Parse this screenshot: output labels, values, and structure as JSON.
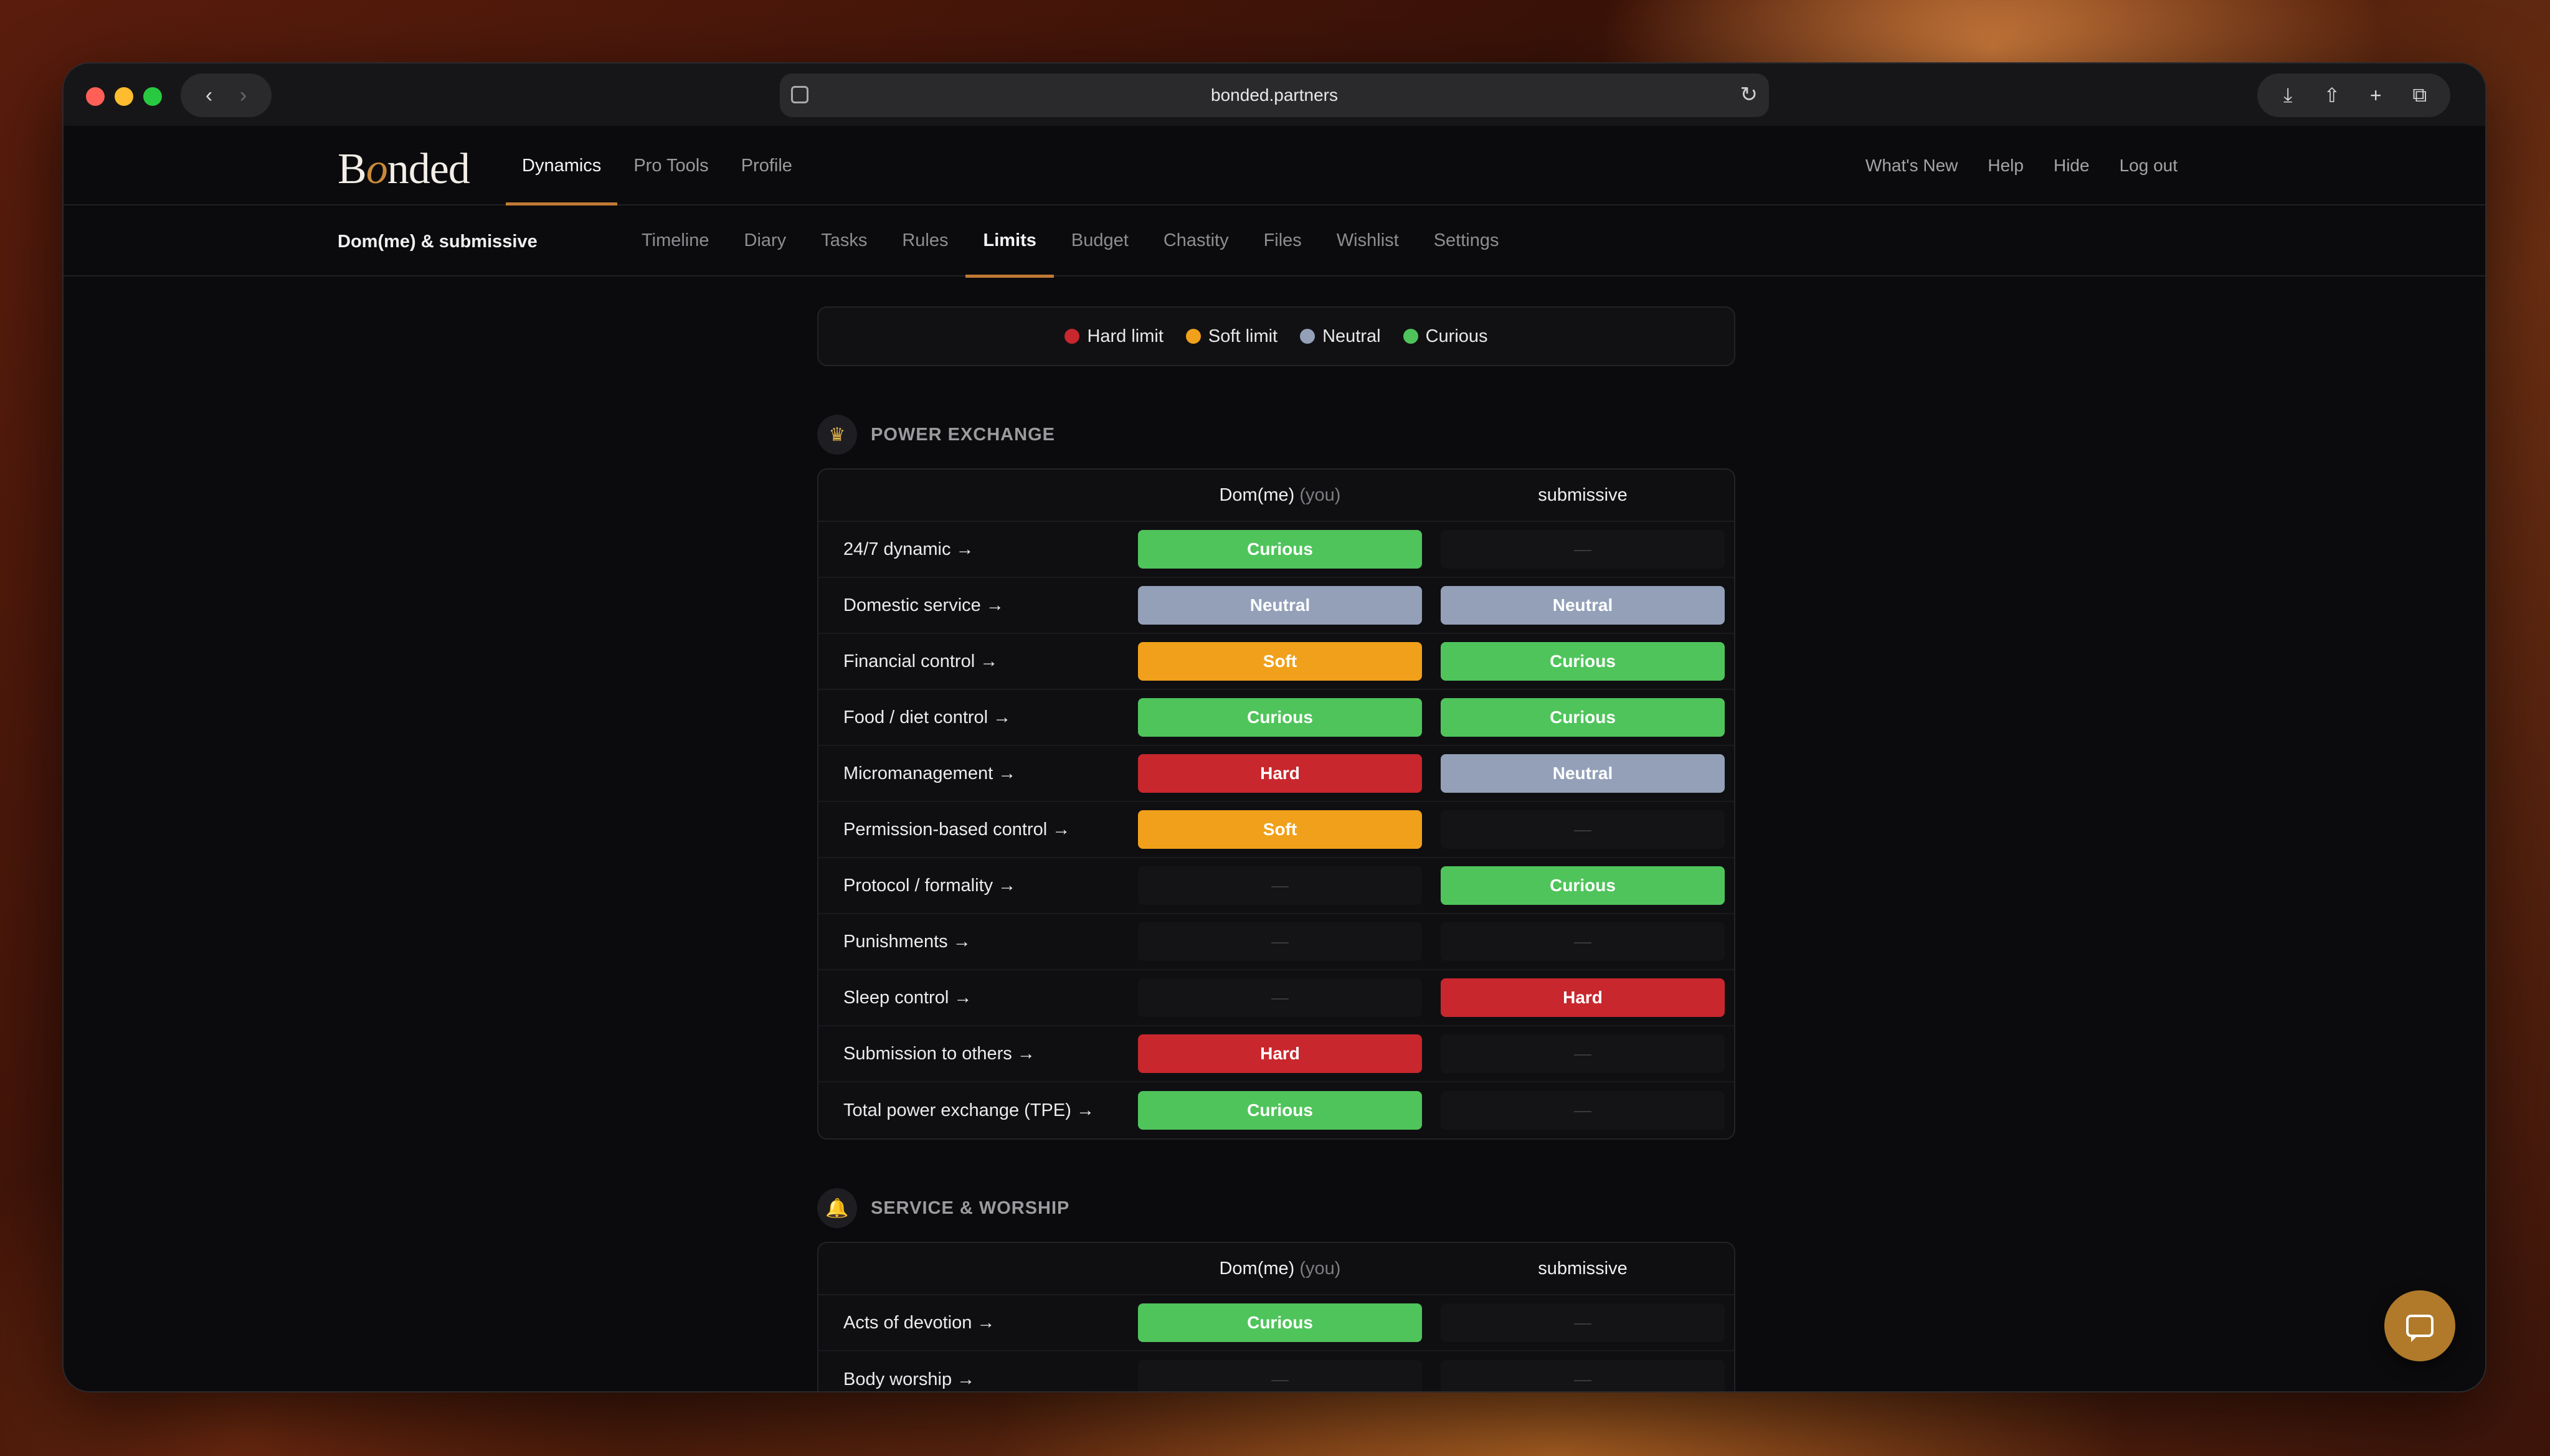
{
  "browser": {
    "url": "bonded.partners",
    "back_icon": "‹",
    "forward_icon": "›",
    "reload_icon": "↻",
    "actions": [
      "⤓",
      "⇧",
      "+",
      "⧉"
    ]
  },
  "app": {
    "logo_prefix": "B",
    "logo_o": "o",
    "logo_suffix": "nded",
    "top_nav": [
      "Dynamics",
      "Pro Tools",
      "Profile"
    ],
    "top_nav_active": "Dynamics",
    "right_nav": [
      "What's New",
      "Help",
      "Hide",
      "Log out"
    ]
  },
  "subnav": {
    "title": "Dom(me) & submissive",
    "items": [
      "Timeline",
      "Diary",
      "Tasks",
      "Rules",
      "Limits",
      "Budget",
      "Chastity",
      "Files",
      "Wishlist",
      "Settings"
    ],
    "active": "Limits"
  },
  "legend": [
    {
      "label": "Hard limit",
      "color": "#c8272d"
    },
    {
      "label": "Soft limit",
      "color": "#f0a01a"
    },
    {
      "label": "Neutral",
      "color": "#93a0b8"
    },
    {
      "label": "Curious",
      "color": "#4fc45b"
    }
  ],
  "columns": {
    "dom": "Dom(me)",
    "you": "(you)",
    "sub": "submissive"
  },
  "sections": [
    {
      "title": "POWER EXCHANGE",
      "icon": "crown-icon",
      "icon_glyph": "♛",
      "rows": [
        {
          "label": "24/7 dynamic →",
          "dom": "Curious",
          "sub": "—"
        },
        {
          "label": "Domestic service →",
          "dom": "Neutral",
          "sub": "Neutral"
        },
        {
          "label": "Financial control →",
          "dom": "Soft",
          "sub": "Curious"
        },
        {
          "label": "Food / diet control →",
          "dom": "Curious",
          "sub": "Curious"
        },
        {
          "label": "Micromanagement →",
          "dom": "Hard",
          "sub": "Neutral"
        },
        {
          "label": "Permission-based control →",
          "dom": "Soft",
          "sub": "—"
        },
        {
          "label": "Protocol / formality →",
          "dom": "—",
          "sub": "Curious"
        },
        {
          "label": "Punishments →",
          "dom": "—",
          "sub": "—"
        },
        {
          "label": "Sleep control →",
          "dom": "—",
          "sub": "Hard"
        },
        {
          "label": "Submission to others →",
          "dom": "Hard",
          "sub": "—"
        },
        {
          "label": "Total power exchange (TPE) →",
          "dom": "Curious",
          "sub": "—"
        }
      ]
    },
    {
      "title": "SERVICE & WORSHIP",
      "icon": "bell-icon",
      "icon_glyph": "🔔",
      "rows": [
        {
          "label": "Acts of devotion →",
          "dom": "Curious",
          "sub": "—"
        },
        {
          "label": "Body worship →",
          "dom": "—",
          "sub": "—"
        }
      ]
    }
  ]
}
